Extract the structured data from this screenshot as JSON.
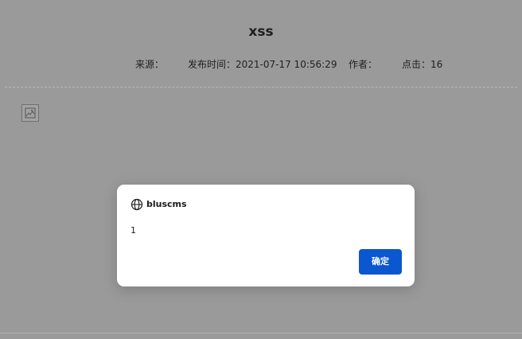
{
  "article": {
    "title": "xss",
    "meta": {
      "source_label": "来源：",
      "publish_label": "发布时间：2021-07-17 10:56:29",
      "author_label": "作者：",
      "clicks_label": "点击：16"
    },
    "image_icon": "broken-image-icon"
  },
  "dialog": {
    "icon": "globe-icon",
    "title": "bluscms",
    "message": "1",
    "ok_label": "确定",
    "ok_color": "#0b57d0"
  },
  "colors": {
    "overlay_background": "#9a9a9b",
    "dialog_background": "#ffffff"
  }
}
